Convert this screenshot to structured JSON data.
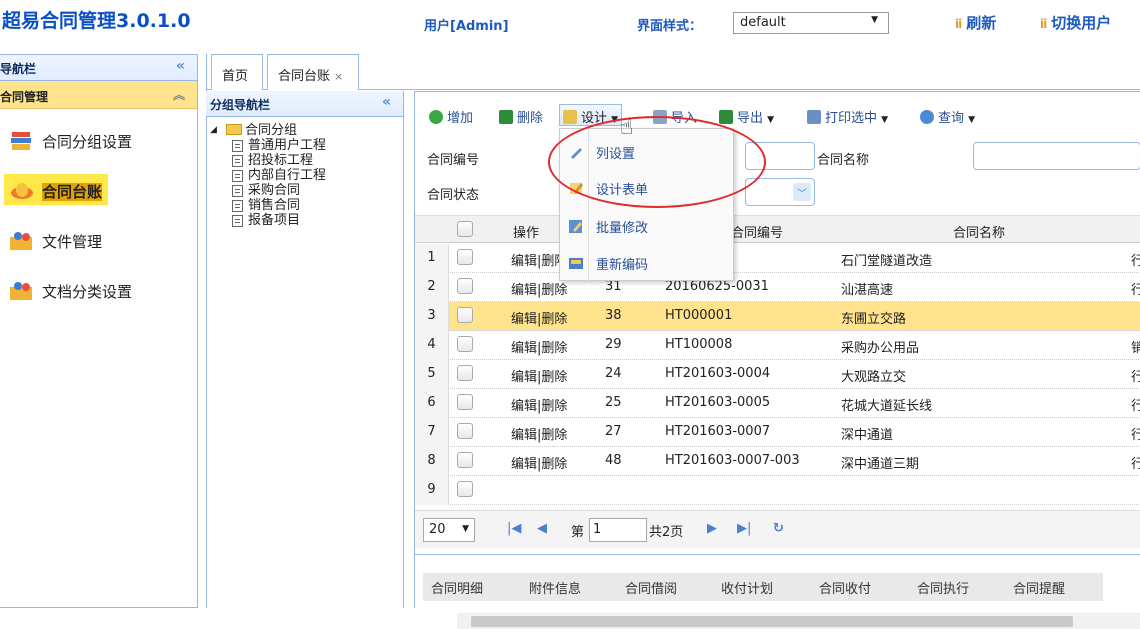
{
  "header": {
    "app_title": "超易合同管理3.0.1.0",
    "user_label": "用户[Admin]",
    "style_label": "界面样式：",
    "style_value": "default",
    "refresh_label": "刷新",
    "switch_user_label": "切换用户"
  },
  "left_nav": {
    "title": "导航栏",
    "section_title": "合同管理",
    "items": [
      {
        "label": "合同分组设置",
        "icon": "books-icon"
      },
      {
        "label": "合同台账",
        "icon": "lotus-icon",
        "active": true
      },
      {
        "label": "文件管理",
        "icon": "folder-people-icon"
      },
      {
        "label": "文档分类设置",
        "icon": "folder-people-icon"
      }
    ]
  },
  "tabs": [
    {
      "label": "首页"
    },
    {
      "label": "合同台账",
      "close": "×"
    }
  ],
  "group_nav": {
    "title": "分组导航栏",
    "root": "合同分组",
    "children": [
      "普通用户工程",
      "招投标工程",
      "内部自行工程",
      "采购合同",
      "销售合同",
      "报备项目"
    ]
  },
  "toolbar": {
    "add": "增加",
    "delete": "删除",
    "design": "设计",
    "import": "导入",
    "export": "导出",
    "print": "打印选中",
    "query": "查询"
  },
  "filters": {
    "contract_no_label": "合同编号",
    "contract_name_label": "合同名称",
    "contract_status_label": "合同状态"
  },
  "grid": {
    "headers": {
      "op": "操作",
      "no": "合同编号",
      "name": "合同名称"
    },
    "rows": [
      {
        "n": "1",
        "op": "编辑|删除",
        "id": "",
        "no": "",
        "name": "石门堂隧道改造",
        "extra": "行"
      },
      {
        "n": "2",
        "op": "编辑|删除",
        "id": "31",
        "no": "20160625-0031",
        "name": "汕湛高速",
        "extra": "行"
      },
      {
        "n": "3",
        "op": "编辑|删除",
        "id": "38",
        "no": "HT000001",
        "name": "东圃立交路",
        "extra": "",
        "selected": true
      },
      {
        "n": "4",
        "op": "编辑|删除",
        "id": "29",
        "no": "HT100008",
        "name": "采购办公用品",
        "extra": "销"
      },
      {
        "n": "5",
        "op": "编辑|删除",
        "id": "24",
        "no": "HT201603-0004",
        "name": "大观路立交",
        "extra": "行"
      },
      {
        "n": "6",
        "op": "编辑|删除",
        "id": "25",
        "no": "HT201603-0005",
        "name": "花城大道延长线",
        "extra": "行"
      },
      {
        "n": "7",
        "op": "编辑|删除",
        "id": "27",
        "no": "HT201603-0007",
        "name": "深中通道",
        "extra": "行"
      },
      {
        "n": "8",
        "op": "编辑|删除",
        "id": "48",
        "no": "HT201603-0007-003",
        "name": "深中通道三期",
        "extra": "行"
      },
      {
        "n": "9",
        "op": "",
        "id": "",
        "no": "",
        "name": "",
        "extra": ""
      }
    ]
  },
  "pager": {
    "page_size": "20",
    "page_label": "第",
    "page_value": "1",
    "total_label": "共2页"
  },
  "detail_tabs": [
    "合同明细",
    "附件信息",
    "合同借阅",
    "收付计划",
    "合同收付",
    "合同执行",
    "合同提醒"
  ],
  "design_menu": {
    "items": [
      {
        "label": "列设置",
        "icon": "wrench-icon"
      },
      {
        "label": "设计表单",
        "icon": "pencil-icon"
      },
      {
        "label": "批量修改",
        "icon": "edit-icon"
      },
      {
        "label": "重新编码",
        "icon": "renumber-icon"
      }
    ]
  },
  "colors": {
    "accent": "#1f5bbf",
    "selected_row": "#ffe48d",
    "annotation": "#e02b2b"
  }
}
